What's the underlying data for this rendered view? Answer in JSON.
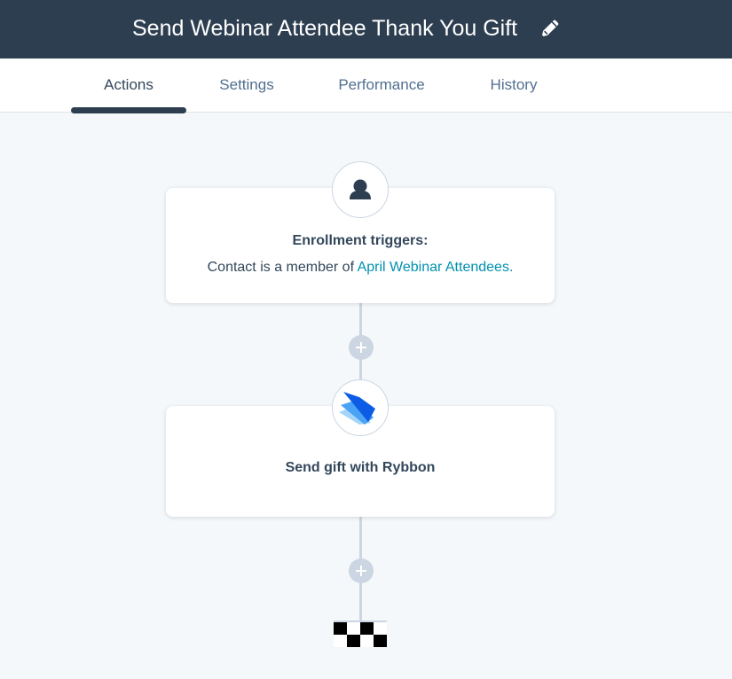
{
  "header": {
    "title": "Send Webinar Attendee Thank You Gift"
  },
  "tabs": [
    {
      "label": "Actions",
      "active": true
    },
    {
      "label": "Settings",
      "active": false
    },
    {
      "label": "Performance",
      "active": false
    },
    {
      "label": "History",
      "active": false
    }
  ],
  "trigger_card": {
    "icon": "contact-person-icon",
    "title": "Enrollment triggers:",
    "desc_prefix": "Contact is a member of ",
    "link_text": "April Webinar Attendees",
    "desc_suffix": "."
  },
  "action_card": {
    "icon": "rybbon-logo-icon",
    "title": "Send gift with Rybbon"
  },
  "end": {
    "icon": "checkered-flag-icon"
  },
  "colors": {
    "header_bg": "#2d3e50",
    "canvas_bg": "#f5f8fa",
    "link": "#0091ae",
    "connector": "#cbd6e2"
  }
}
